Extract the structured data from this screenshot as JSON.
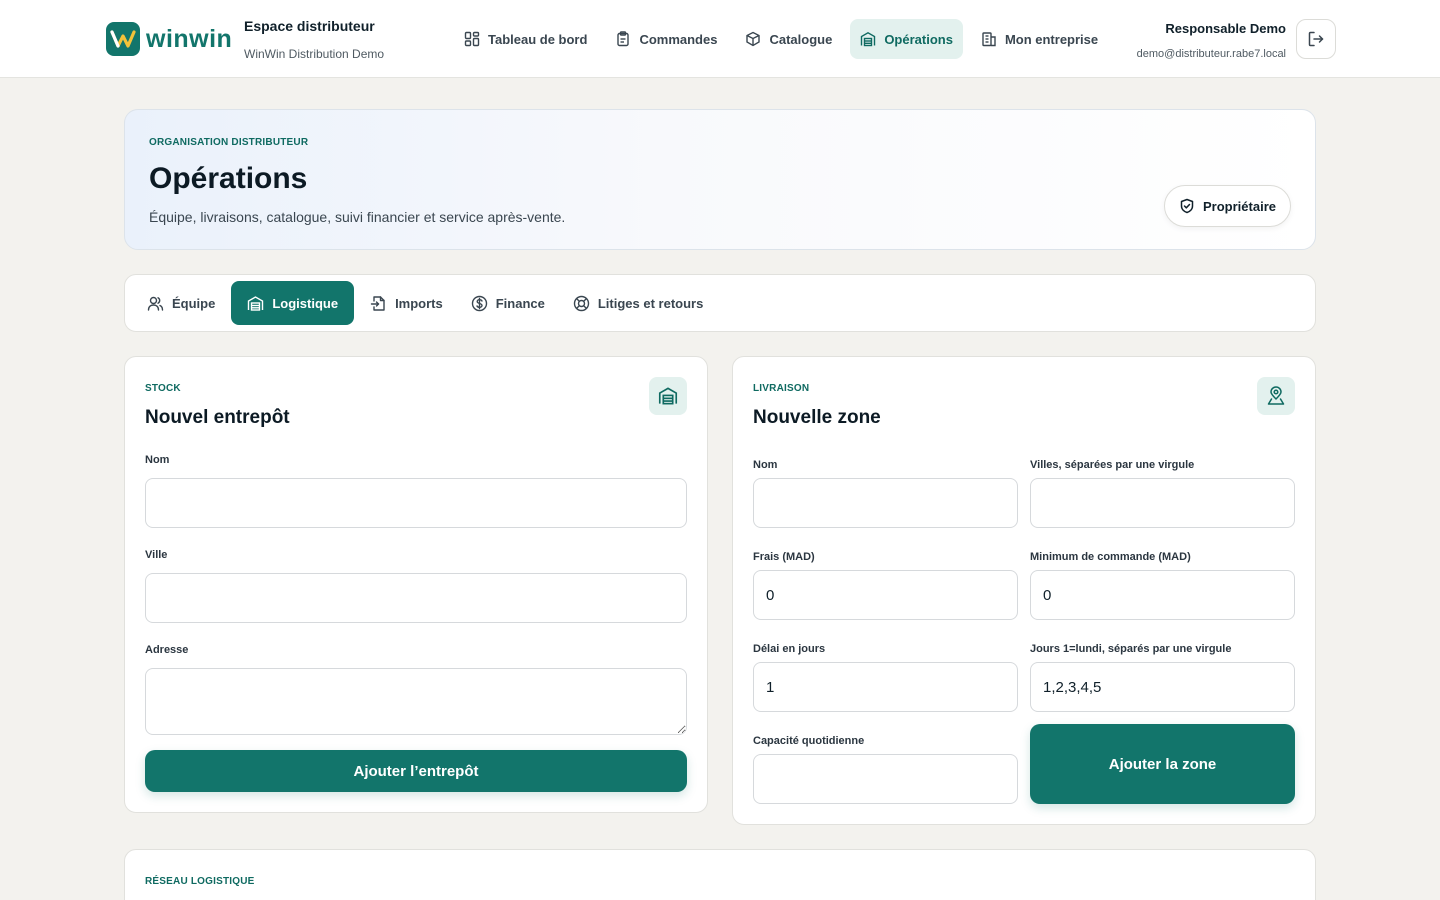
{
  "header": {
    "brand_name": "winwin",
    "space_title": "Espace distributeur",
    "org_name": "WinWin Distribution Demo",
    "nav": [
      {
        "label": "Tableau de bord",
        "icon": "dashboard-icon"
      },
      {
        "label": "Commandes",
        "icon": "clipboard-icon"
      },
      {
        "label": "Catalogue",
        "icon": "package-icon"
      },
      {
        "label": "Opérations",
        "icon": "warehouse-icon",
        "active": true
      },
      {
        "label": "Mon entreprise",
        "icon": "building-icon"
      }
    ],
    "user_name": "Responsable Demo",
    "user_email": "demo@distributeur.rabe7.local"
  },
  "hero": {
    "eyebrow": "ORGANISATION DISTRIBUTEUR",
    "title": "Opérations",
    "description": "Équipe, livraisons, catalogue, suivi financier et service après-vente.",
    "role_badge": "Propriétaire"
  },
  "tabs": [
    {
      "label": "Équipe",
      "icon": "users-icon"
    },
    {
      "label": "Logistique",
      "icon": "warehouse-icon",
      "active": true
    },
    {
      "label": "Imports",
      "icon": "file-import-icon"
    },
    {
      "label": "Finance",
      "icon": "dollar-icon"
    },
    {
      "label": "Litiges et retours",
      "icon": "lifebuoy-icon"
    }
  ],
  "warehouse_card": {
    "eyebrow": "STOCK",
    "title": "Nouvel entrepôt",
    "fields": {
      "name_label": "Nom",
      "name_value": "",
      "city_label": "Ville",
      "city_value": "",
      "address_label": "Adresse",
      "address_value": ""
    },
    "submit_label": "Ajouter l’entrepôt"
  },
  "zone_card": {
    "eyebrow": "LIVRAISON",
    "title": "Nouvelle zone",
    "fields": {
      "name_label": "Nom",
      "name_value": "",
      "cities_label": "Villes, séparées par une virgule",
      "cities_value": "",
      "fee_label": "Frais (MAD)",
      "fee_value": "0",
      "min_order_label": "Minimum de commande (MAD)",
      "min_order_value": "0",
      "delay_label": "Délai en jours",
      "delay_value": "1",
      "days_label": "Jours 1=lundi, séparés par une virgule",
      "days_value": "1,2,3,4,5",
      "capacity_label": "Capacité quotidienne",
      "capacity_value": ""
    },
    "submit_label": "Ajouter la zone"
  },
  "network_card": {
    "eyebrow": "RÉSEAU LOGISTIQUE"
  },
  "colors": {
    "brand": "#12756b",
    "brand_light": "#e3f1ee",
    "background": "#f3f2ee"
  }
}
